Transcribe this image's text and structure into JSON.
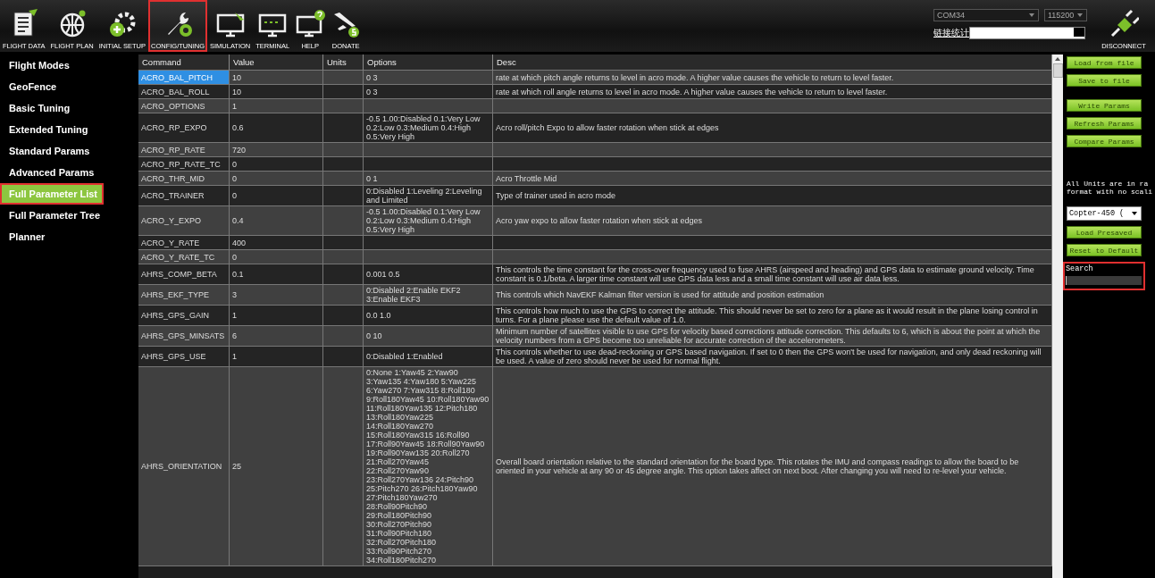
{
  "toolbar": {
    "items": [
      {
        "label": "FLIGHT DATA",
        "selected": false,
        "highlighted": false
      },
      {
        "label": "FLIGHT PLAN",
        "selected": false,
        "highlighted": false
      },
      {
        "label": "INITIAL SETUP",
        "selected": false,
        "highlighted": false
      },
      {
        "label": "CONFIG/TUNING",
        "selected": true,
        "highlighted": true
      },
      {
        "label": "SIMULATION",
        "selected": false,
        "highlighted": false
      },
      {
        "label": "TERMINAL",
        "selected": false,
        "highlighted": false
      },
      {
        "label": "HELP",
        "selected": false,
        "highlighted": false
      },
      {
        "label": "DONATE",
        "selected": false,
        "highlighted": false
      }
    ],
    "port": "COM34",
    "baud": "115200",
    "link_stats": "链接统计",
    "disconnect": "DISCONNECT"
  },
  "sidebar": {
    "items": [
      {
        "label": "Flight Modes",
        "selected": false,
        "highlighted": false
      },
      {
        "label": "GeoFence",
        "selected": false,
        "highlighted": false
      },
      {
        "label": "Basic Tuning",
        "selected": false,
        "highlighted": false
      },
      {
        "label": "Extended Tuning",
        "selected": false,
        "highlighted": false
      },
      {
        "label": "Standard Params",
        "selected": false,
        "highlighted": false
      },
      {
        "label": "Advanced Params",
        "selected": false,
        "highlighted": false
      },
      {
        "label": "Full Parameter List",
        "selected": true,
        "highlighted": true
      },
      {
        "label": "Full Parameter Tree",
        "selected": false,
        "highlighted": false
      },
      {
        "label": "Planner",
        "selected": false,
        "highlighted": false
      }
    ]
  },
  "table": {
    "columns": [
      "Command",
      "Value",
      "Units",
      "Options",
      "Desc"
    ],
    "rows": [
      {
        "command": "ACRO_BAL_PITCH",
        "value": "10",
        "options": "0 3",
        "desc": "rate at which pitch angle returns to level in acro mode.  A higher value causes the vehicle to return to level faster.",
        "selected": true
      },
      {
        "command": "ACRO_BAL_ROLL",
        "value": "10",
        "options": "0 3",
        "desc": "rate at which roll angle returns to level in acro mode.  A higher value causes the vehicle to return to level faster.",
        "selected": false
      },
      {
        "command": "ACRO_OPTIONS",
        "value": "1",
        "selected": false
      },
      {
        "command": "ACRO_RP_EXPO",
        "value": "0.6",
        "options": "-0.5 1.00:Disabled 0.1:Very Low\n0.2:Low 0.3:Medium 0.4:High\n0.5:Very High",
        "desc": "Acro roll/pitch Expo to allow faster rotation when stick at edges",
        "selected": false
      },
      {
        "command": "ACRO_RP_RATE",
        "value": "720",
        "selected": false
      },
      {
        "command": "ACRO_RP_RATE_TC",
        "value": "0",
        "selected": false
      },
      {
        "command": "ACRO_THR_MID",
        "value": "0",
        "options": "0 1",
        "desc": "Acro Throttle Mid",
        "selected": false
      },
      {
        "command": "ACRO_TRAINER",
        "value": "0",
        "options": "0:Disabled 1:Leveling 2:Leveling\nand Limited",
        "desc": "Type of trainer used in acro mode",
        "selected": false
      },
      {
        "command": "ACRO_Y_EXPO",
        "value": "0.4",
        "options": "-0.5 1.00:Disabled 0.1:Very Low\n0.2:Low 0.3:Medium 0.4:High\n0.5:Very High",
        "desc": "Acro yaw expo to allow faster rotation when stick at edges",
        "selected": false
      },
      {
        "command": "ACRO_Y_RATE",
        "value": "400",
        "selected": false
      },
      {
        "command": "ACRO_Y_RATE_TC",
        "value": "0",
        "selected": false
      },
      {
        "command": "AHRS_COMP_BETA",
        "value": "0.1",
        "options": "0.001 0.5",
        "desc": "This controls the time constant for the cross-over frequency used to fuse AHRS (airspeed and heading) and GPS data to estimate ground velocity. Time constant is 0.1/beta. A larger time constant will use GPS data less and a small time constant will use air data less.",
        "selected": false
      },
      {
        "command": "AHRS_EKF_TYPE",
        "value": "3",
        "options": "0:Disabled 2:Enable EKF2\n3:Enable EKF3",
        "desc": "This controls which NavEKF Kalman filter version is used for attitude and position estimation",
        "selected": false
      },
      {
        "command": "AHRS_GPS_GAIN",
        "value": "1",
        "options": "0.0 1.0",
        "desc": "This controls how much to use the GPS to correct the attitude. This should never be set to zero for a plane as it would result in the plane losing control in turns. For a plane please use the default value of 1.0.",
        "selected": false
      },
      {
        "command": "AHRS_GPS_MINSATS",
        "value": "6",
        "options": "0 10",
        "desc": "Minimum number of satellites visible to use GPS for velocity based corrections attitude correction. This defaults to 6, which is about the point at which the velocity numbers from a GPS become too unreliable for accurate correction of the accelerometers.",
        "selected": false
      },
      {
        "command": "AHRS_GPS_USE",
        "value": "1",
        "options": "0:Disabled 1:Enabled",
        "desc": "This controls whether to use dead-reckoning or GPS based navigation. If set to 0 then the GPS won't be used for navigation, and only dead reckoning will be used. A value of zero should never be used for normal flight.",
        "selected": false
      },
      {
        "command": "AHRS_ORIENTATION",
        "value": "25",
        "options": "0:None 1:Yaw45 2:Yaw90\n3:Yaw135 4:Yaw180 5:Yaw225\n6:Yaw270 7:Yaw315 8:Roll180\n9:Roll180Yaw45 10:Roll180Yaw90\n11:Roll180Yaw135 12:Pitch180\n13:Roll180Yaw225\n14:Roll180Yaw270\n15:Roll180Yaw315 16:Roll90\n17:Roll90Yaw45 18:Roll90Yaw90\n19:Roll90Yaw135 20:Roll270\n21:Roll270Yaw45\n22:Roll270Yaw90\n23:Roll270Yaw136 24:Pitch90\n25:Pitch270 26:Pitch180Yaw90\n27:Pitch180Yaw270\n28:Roll90Pitch90\n29:Roll180Pitch90\n30:Roll270Pitch90\n31:Roll90Pitch180\n32:Roll270Pitch180\n33:Roll90Pitch270\n34:Roll180Pitch270",
        "desc": "Overall board orientation relative to the standard orientation for the board type. This rotates the IMU and compass readings to allow the board to be oriented in your vehicle at any 90 or 45 degree angle. This option takes affect on next boot. After changing you will need to re-level your vehicle.",
        "selected": false
      }
    ]
  },
  "right_panel": {
    "buttons_top": [
      "Load from file",
      "Save to file"
    ],
    "buttons_mid": [
      "Write Params",
      "Refresh Params",
      "Compare Params"
    ],
    "note_lines": [
      "All Units are in ra",
      "format with no scali"
    ],
    "preset": "Copter-450 (",
    "buttons_bottom": [
      "Load Presaved",
      "Reset to Default"
    ],
    "search": {
      "label": "Search",
      "highlighted": true
    }
  }
}
